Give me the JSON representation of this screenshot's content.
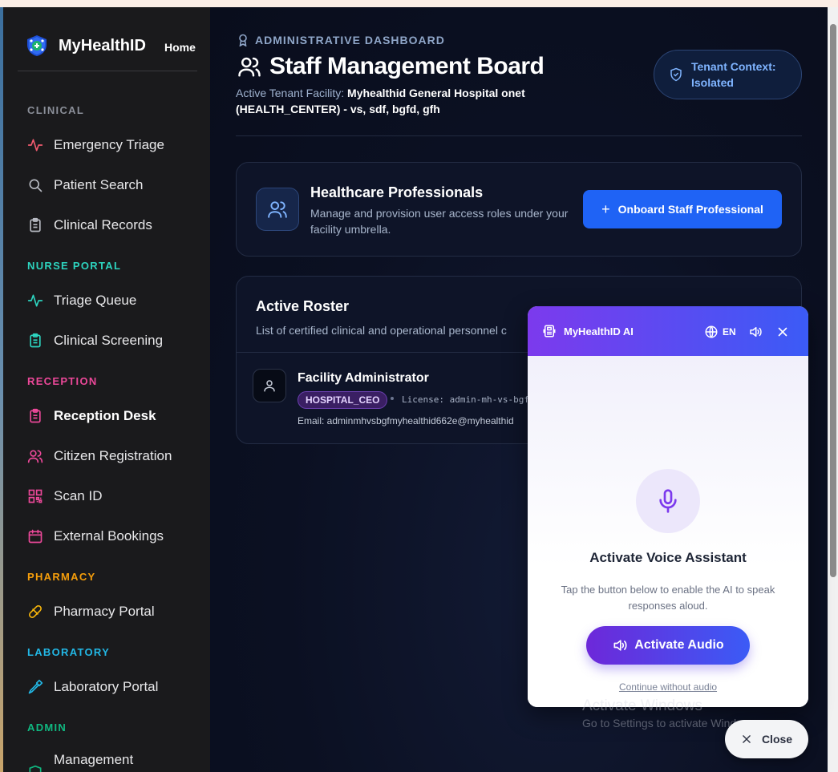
{
  "brand": {
    "name": "MyHealthID",
    "home": "Home"
  },
  "sidebar": {
    "sections": [
      {
        "label": "CLINICAL",
        "color": "#8b8f99",
        "items": [
          {
            "label": "Emergency Triage",
            "icon": "activity-icon"
          },
          {
            "label": "Patient Search",
            "icon": "search-icon"
          },
          {
            "label": "Clinical Records",
            "icon": "clipboard-icon"
          }
        ]
      },
      {
        "label": "NURSE PORTAL",
        "color": "#2dd4bf",
        "items": [
          {
            "label": "Triage Queue",
            "icon": "activity-icon"
          },
          {
            "label": "Clinical Screening",
            "icon": "clipboard-icon"
          }
        ]
      },
      {
        "label": "RECEPTION",
        "color": "#ec4899",
        "items": [
          {
            "label": "Reception Desk",
            "icon": "clipboard-icon"
          },
          {
            "label": "Citizen Registration",
            "icon": "users-icon"
          },
          {
            "label": "Scan ID",
            "icon": "qr-code-icon"
          },
          {
            "label": "External Bookings",
            "icon": "calendar-icon"
          }
        ]
      },
      {
        "label": "PHARMACY",
        "color": "#f59e0b",
        "items": [
          {
            "label": "Pharmacy Portal",
            "icon": "pill-icon"
          }
        ]
      },
      {
        "label": "LABORATORY",
        "color": "#22b8e6",
        "items": [
          {
            "label": "Laboratory Portal",
            "icon": "pipette-icon"
          }
        ]
      },
      {
        "label": "ADMIN",
        "color": "#10b981",
        "items": [
          {
            "label": "Management",
            "icon": "shield-icon"
          }
        ]
      }
    ]
  },
  "header": {
    "breadcrumb": "ADMINISTRATIVE DASHBOARD",
    "title": "Staff Management Board",
    "facility_label": "Active Tenant Facility:",
    "facility_value": "Myhealthid General Hospital onet (HEALTH_CENTER) - vs, sdf, bgfd, gfh",
    "tenant_badge": "Tenant Context: Isolated"
  },
  "professionals_card": {
    "title": "Healthcare Professionals",
    "subtitle": "Manage and provision user access roles under your facility umbrella.",
    "button": "Onboard Staff Professional"
  },
  "roster": {
    "title": "Active Roster",
    "subtitle": "List of certified clinical and operational personnel c",
    "staff": [
      {
        "name": "Facility Administrator",
        "role": "HOSPITAL_CEO",
        "license": "License: admin-mh-vs-bgf",
        "email": "Email: adminmhvsbgfmyhealthid662e@myhealthid"
      }
    ]
  },
  "ai_panel": {
    "title": "MyHealthID AI",
    "lang": "EN",
    "heading": "Activate Voice Assistant",
    "description": "Tap the button below to enable the AI to speak responses aloud.",
    "activate_button": "Activate Audio",
    "continue_link": "Continue without audio"
  },
  "watermark": {
    "line1": "Activate Windows",
    "line2": "Go to Settings to activate Windows."
  },
  "close_button": "Close",
  "colors": {
    "accent_blue": "#1f63f5",
    "ai_purple": "#7c3aed",
    "sidebar_bg": "#1a1a1c",
    "main_bg": "#0b1022"
  }
}
